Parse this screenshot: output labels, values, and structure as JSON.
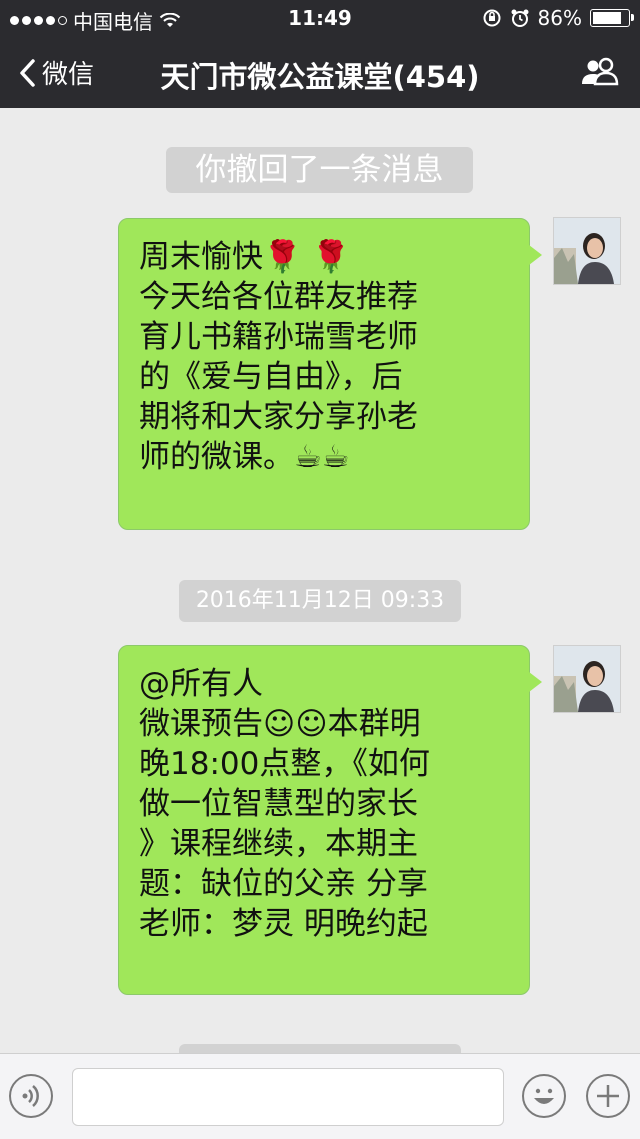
{
  "status_bar": {
    "carrier": "中国电信",
    "time": "11:49",
    "battery": "86%",
    "battery_level": 0.86,
    "signal_dots_filled": 4,
    "signal_dots_total": 5
  },
  "nav": {
    "back_label": "微信",
    "title": "天门市微公益课堂(454)",
    "group_members_icon": "people-icon"
  },
  "chat": {
    "recall_notice": "你撤回了一条消息",
    "message1": {
      "lines": [
        "周末愉快🌹 🌹",
        "今天给各位群友推荐",
        "育儿书籍孙瑞雪老师",
        "的《爱与自由》，后",
        "期将和大家分享孙老",
        "师的微课。☕☕"
      ]
    },
    "timestamp": "2016年11月12日 09:33",
    "message2": {
      "lines": [
        "@所有人",
        "微课预告☺☺本群明",
        "晚18:00点整，《如何",
        "做一位智慧型的家长",
        "》课程继续，本期主",
        "题：缺位的父亲  分享",
        "老师：梦灵   明晚约起"
      ]
    }
  },
  "input_bar": {
    "voice_icon": "voice-icon",
    "emoji_icon": "smiley-icon",
    "more_icon": "plus-icon",
    "text_value": ""
  },
  "colors": {
    "nav_bg": "#2b2b2f",
    "bubble_green": "#a0e75a",
    "chat_bg": "#ebebeb"
  }
}
